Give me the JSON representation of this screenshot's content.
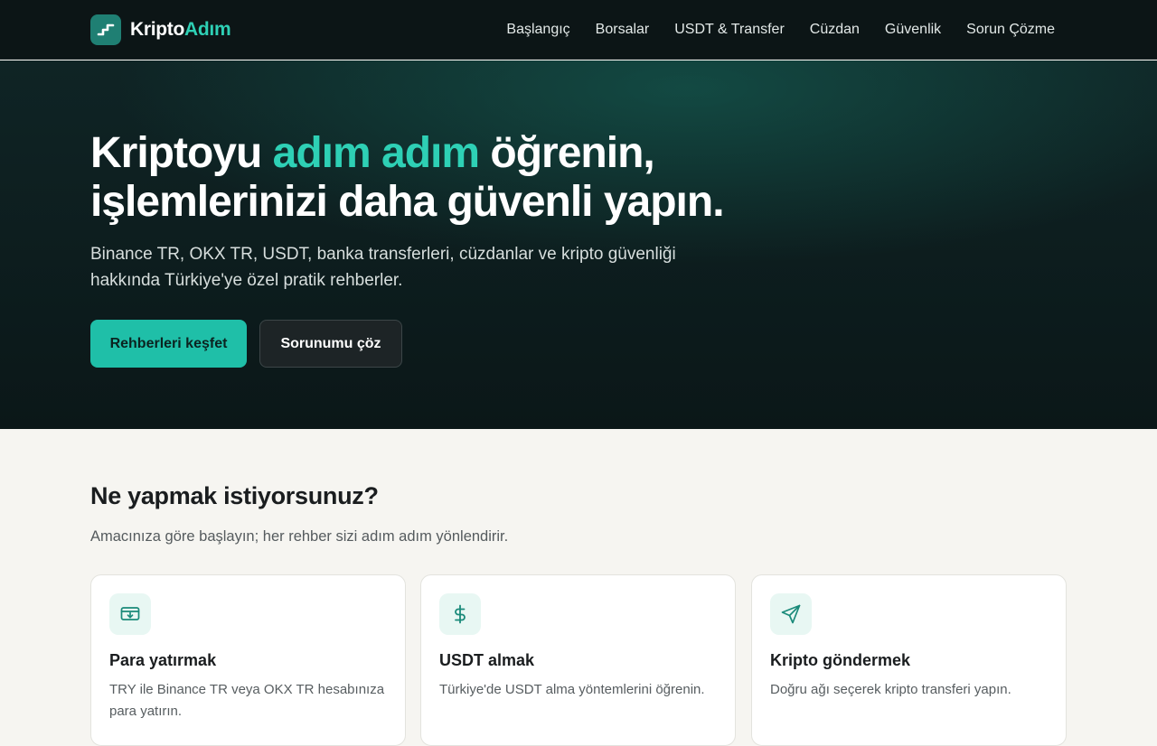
{
  "brand": {
    "name_main": "Kripto",
    "name_accent": "Adım",
    "logo_icon": "stairs-icon"
  },
  "nav": {
    "items": [
      {
        "label": "Başlangıç"
      },
      {
        "label": "Borsalar"
      },
      {
        "label": "USDT & Transfer"
      },
      {
        "label": "Cüzdan"
      },
      {
        "label": "Güvenlik"
      },
      {
        "label": "Sorun Çözme"
      }
    ]
  },
  "hero": {
    "title_part1": "Kriptoyu ",
    "title_accent": "adım adım",
    "title_part2": " öğrenin, işlemlerinizi daha güvenli yapın.",
    "subtitle": "Binance TR, OKX TR, USDT, banka transferleri, cüzdanlar ve kripto güvenliği hakkında Türkiye'ye özel pratik rehberler.",
    "primary_cta": "Rehberleri keşfet",
    "secondary_cta": "Sorunumu çöz"
  },
  "section": {
    "title": "Ne yapmak istiyorsunuz?",
    "subtitle": "Amacınıza göre başlayın; her rehber sizi adım adım yönlendirir."
  },
  "cards": [
    {
      "icon": "deposit-icon",
      "title": "Para yatırmak",
      "text": "TRY ile Binance TR veya OKX TR hesabınıza para yatırın."
    },
    {
      "icon": "dollar-icon",
      "title": "USDT almak",
      "text": "Türkiye'de USDT alma yöntemlerini öğrenin."
    },
    {
      "icon": "send-icon",
      "title": "Kripto göndermek",
      "text": "Doğru ağı seçerek kripto transferi yapın."
    }
  ],
  "colors": {
    "accent": "#2ed0b5",
    "primary_button": "#1fbfa8",
    "header_bg": "#0c1516",
    "page_bg": "#f6f5f1"
  }
}
